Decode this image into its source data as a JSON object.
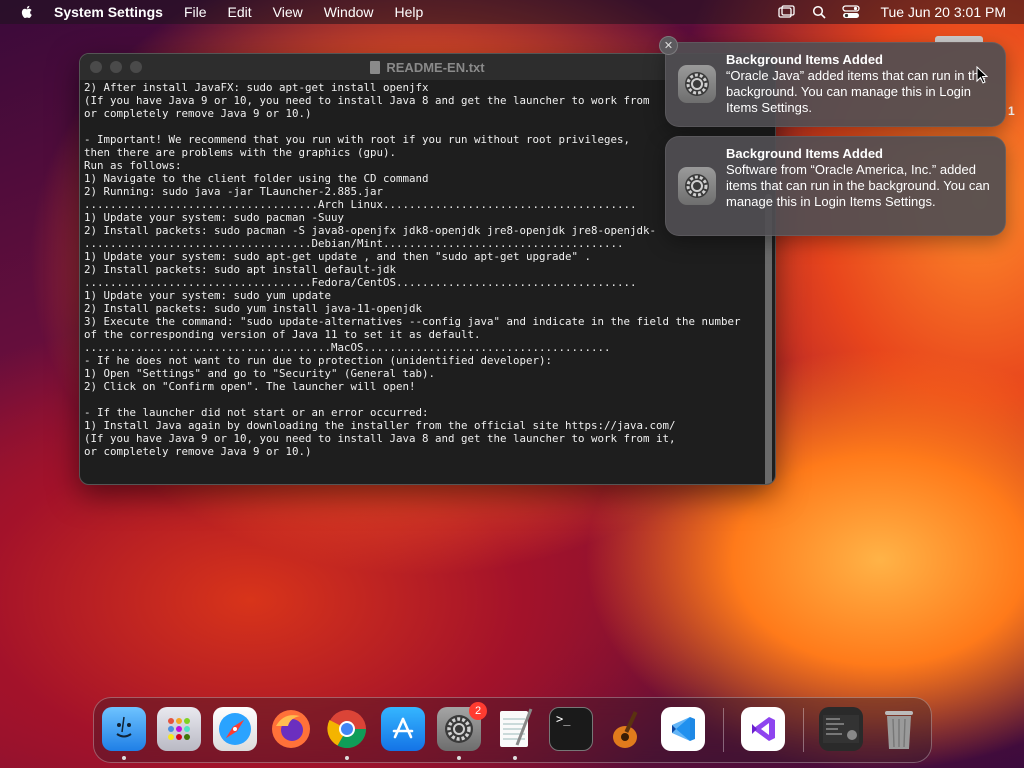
{
  "menubar": {
    "app_name": "System Settings",
    "items": [
      "File",
      "Edit",
      "View",
      "Window",
      "Help"
    ],
    "clock": "Tue Jun 20  3:01 PM"
  },
  "window": {
    "title": "README-EN.txt",
    "lines": [
      "2) After install JavaFX: sudo apt-get install openjfx",
      "(If you have Java 9 or 10, you need to install Java 8 and get the launcher to work from",
      "or completely remove Java 9 or 10.)",
      "",
      "- Important! We recommend that you run with root if you run without root privileges,",
      "then there are problems with the graphics (gpu).",
      "Run as follows:",
      "1) Navigate to the client folder using the CD command",
      "2) Running: sudo java -jar TLauncher-2.885.jar",
      "....................................Arch Linux.......................................",
      "1) Update your system: sudo pacman -Suuy",
      "2) Install packets: sudo pacman -S java8-openjfx jdk8-openjdk jre8-openjdk jre8-openjdk-",
      "...................................Debian/Mint.....................................",
      "1) Update your system: sudo apt-get update , and then \"sudo apt-get upgrade\" .",
      "2) Install packets: sudo apt install default-jdk",
      "...................................Fedora/CentOS.....................................",
      "1) Update your system: sudo yum update",
      "2) Install packets: sudo yum install java-11-openjdk",
      "3) Execute the command: \"sudo update-alternatives --config java\" and indicate in the field the number",
      "of the corresponding version of Java 11 to set it as default.",
      "......................................MacOS......................................",
      "- If he does not want to run due to protection (unidentified developer):",
      "1) Open \"Settings\" and go to \"Security\" (General tab).",
      "2) Click on \"Confirm open\". The launcher will open!",
      "",
      "- If the launcher did not start or an error occurred:",
      "1) Install Java again by downloading the installer from the official site https://java.com/",
      "(If you have Java 9 or 10, you need to install Java 8 and get the launcher to work from it,",
      "or completely remove Java 9 or 10.)"
    ]
  },
  "notifications": [
    {
      "title": "Background Items Added",
      "body": "“Oracle Java” added items that can run in the background. You can manage this in Login Items Settings."
    },
    {
      "title": "Background Items Added",
      "body": "Software from “Oracle America, Inc.” added items that can run in the background. You can manage this in Login Items Settings."
    }
  ],
  "side_digit": "1",
  "dock": {
    "settings_badge": "2",
    "terminal_prompt": ">_",
    "items": [
      "finder-icon",
      "launchpad-icon",
      "safari-icon",
      "firefox-icon",
      "chrome-icon",
      "app-store-icon",
      "system-settings-icon",
      "textedit-icon",
      "terminal-icon",
      "garageband-icon",
      "vscode-icon",
      "visual-studio-icon",
      "window-preview-icon",
      "trash-icon"
    ]
  },
  "colors": {
    "notif_bg": "#504e52",
    "terminal_bg": "#1e1e1e",
    "badge": "#ff3b30"
  }
}
